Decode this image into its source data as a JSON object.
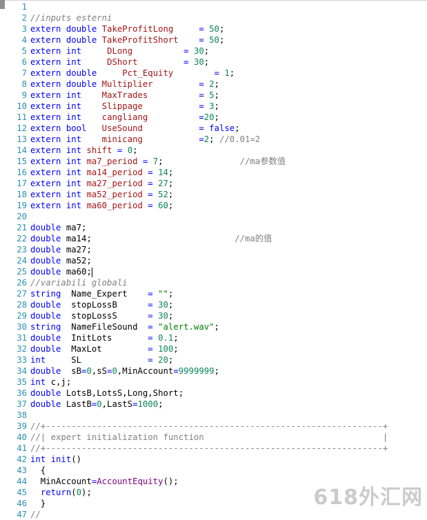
{
  "editor": {
    "lines": [
      {
        "n": "1",
        "t": []
      },
      {
        "n": "2",
        "t": [
          [
            "cm",
            "//inputs esterni"
          ]
        ]
      },
      {
        "n": "3",
        "t": [
          [
            "kw",
            "extern"
          ],
          [
            "pl",
            " "
          ],
          [
            "ty",
            "double"
          ],
          [
            "pl",
            " "
          ],
          [
            "var",
            "TakeProfitLong"
          ],
          [
            "pl",
            "     "
          ],
          [
            "kw",
            "="
          ],
          [
            "pl",
            " "
          ],
          [
            "num",
            "50"
          ],
          [
            "pl",
            ";"
          ]
        ]
      },
      {
        "n": "4",
        "t": [
          [
            "kw",
            "extern"
          ],
          [
            "pl",
            " "
          ],
          [
            "ty",
            "double"
          ],
          [
            "pl",
            " "
          ],
          [
            "var",
            "TakeProfitShort"
          ],
          [
            "pl",
            "    "
          ],
          [
            "kw",
            "="
          ],
          [
            "pl",
            " "
          ],
          [
            "num",
            "50"
          ],
          [
            "pl",
            ";"
          ]
        ]
      },
      {
        "n": "5",
        "t": [
          [
            "kw",
            "extern"
          ],
          [
            "pl",
            " "
          ],
          [
            "ty",
            "int"
          ],
          [
            "pl",
            "     "
          ],
          [
            "var",
            "DLong"
          ],
          [
            "pl",
            "          "
          ],
          [
            "kw",
            "="
          ],
          [
            "pl",
            " "
          ],
          [
            "num",
            "30"
          ],
          [
            "pl",
            ";"
          ]
        ]
      },
      {
        "n": "6",
        "t": [
          [
            "kw",
            "extern"
          ],
          [
            "pl",
            " "
          ],
          [
            "ty",
            "int"
          ],
          [
            "pl",
            "     "
          ],
          [
            "var",
            "DShort"
          ],
          [
            "pl",
            "         "
          ],
          [
            "kw",
            "="
          ],
          [
            "pl",
            " "
          ],
          [
            "num",
            "30"
          ],
          [
            "pl",
            ";"
          ]
        ]
      },
      {
        "n": "7",
        "t": [
          [
            "kw",
            "extern"
          ],
          [
            "pl",
            " "
          ],
          [
            "ty",
            "double"
          ],
          [
            "pl",
            "     "
          ],
          [
            "var",
            "Pct_Equity"
          ],
          [
            "pl",
            "        "
          ],
          [
            "kw",
            "="
          ],
          [
            "pl",
            " "
          ],
          [
            "num",
            "1"
          ],
          [
            "pl",
            ";"
          ]
        ]
      },
      {
        "n": "8",
        "t": [
          [
            "kw",
            "extern"
          ],
          [
            "pl",
            " "
          ],
          [
            "ty",
            "double"
          ],
          [
            "pl",
            " "
          ],
          [
            "var",
            "Multiplier"
          ],
          [
            "pl",
            "         "
          ],
          [
            "kw",
            "="
          ],
          [
            "pl",
            " "
          ],
          [
            "num",
            "2"
          ],
          [
            "pl",
            ";"
          ]
        ]
      },
      {
        "n": "9",
        "t": [
          [
            "kw",
            "extern"
          ],
          [
            "pl",
            " "
          ],
          [
            "ty",
            "int"
          ],
          [
            "pl",
            "    "
          ],
          [
            "var",
            "MaxTrades"
          ],
          [
            "pl",
            "          "
          ],
          [
            "kw",
            "="
          ],
          [
            "pl",
            " "
          ],
          [
            "num",
            "5"
          ],
          [
            "pl",
            ";"
          ]
        ]
      },
      {
        "n": "10",
        "t": [
          [
            "kw",
            "extern"
          ],
          [
            "pl",
            " "
          ],
          [
            "ty",
            "int"
          ],
          [
            "pl",
            "    "
          ],
          [
            "var",
            "Slippage"
          ],
          [
            "pl",
            "           "
          ],
          [
            "kw",
            "="
          ],
          [
            "pl",
            " "
          ],
          [
            "num",
            "3"
          ],
          [
            "pl",
            ";"
          ]
        ]
      },
      {
        "n": "11",
        "t": [
          [
            "kw",
            "extern"
          ],
          [
            "pl",
            " "
          ],
          [
            "ty",
            "int"
          ],
          [
            "pl",
            "    "
          ],
          [
            "var",
            "cangliang"
          ],
          [
            "pl",
            "          "
          ],
          [
            "kw",
            "="
          ],
          [
            "num",
            "20"
          ],
          [
            "pl",
            ";"
          ]
        ]
      },
      {
        "n": "12",
        "t": [
          [
            "kw",
            "extern"
          ],
          [
            "pl",
            " "
          ],
          [
            "ty",
            "bool"
          ],
          [
            "pl",
            "   "
          ],
          [
            "var",
            "UseSound"
          ],
          [
            "pl",
            "           "
          ],
          [
            "kw",
            "="
          ],
          [
            "pl",
            " "
          ],
          [
            "kw",
            "false"
          ],
          [
            "pl",
            ";"
          ]
        ]
      },
      {
        "n": "13",
        "t": [
          [
            "kw",
            "extern"
          ],
          [
            "pl",
            " "
          ],
          [
            "ty",
            "int"
          ],
          [
            "pl",
            "    "
          ],
          [
            "var",
            "minicang"
          ],
          [
            "pl",
            "           "
          ],
          [
            "kw",
            "="
          ],
          [
            "num",
            "2"
          ],
          [
            "pl",
            "; "
          ],
          [
            "cmn",
            "//0.01=2"
          ]
        ]
      },
      {
        "n": "14",
        "t": [
          [
            "kw",
            "extern"
          ],
          [
            "pl",
            " "
          ],
          [
            "ty",
            "int"
          ],
          [
            "pl",
            " "
          ],
          [
            "var",
            "shift"
          ],
          [
            "pl",
            " "
          ],
          [
            "kw",
            "="
          ],
          [
            "pl",
            " "
          ],
          [
            "num",
            "0"
          ],
          [
            "pl",
            ";"
          ]
        ]
      },
      {
        "n": "15",
        "t": [
          [
            "kw",
            "extern"
          ],
          [
            "pl",
            " "
          ],
          [
            "ty",
            "int"
          ],
          [
            "pl",
            " "
          ],
          [
            "var",
            "ma7_period"
          ],
          [
            "pl",
            " "
          ],
          [
            "kw",
            "="
          ],
          [
            "pl",
            " "
          ],
          [
            "num",
            "7"
          ],
          [
            "pl",
            ";"
          ],
          [
            "pl",
            "               "
          ],
          [
            "cmn",
            "//ma参数值"
          ]
        ]
      },
      {
        "n": "16",
        "t": [
          [
            "kw",
            "extern"
          ],
          [
            "pl",
            " "
          ],
          [
            "ty",
            "int"
          ],
          [
            "pl",
            " "
          ],
          [
            "var",
            "ma14_period"
          ],
          [
            "pl",
            " "
          ],
          [
            "kw",
            "="
          ],
          [
            "pl",
            " "
          ],
          [
            "num",
            "14"
          ],
          [
            "pl",
            ";"
          ]
        ]
      },
      {
        "n": "17",
        "t": [
          [
            "kw",
            "extern"
          ],
          [
            "pl",
            " "
          ],
          [
            "ty",
            "int"
          ],
          [
            "pl",
            " "
          ],
          [
            "var",
            "ma27_period"
          ],
          [
            "pl",
            " "
          ],
          [
            "kw",
            "="
          ],
          [
            "pl",
            " "
          ],
          [
            "num",
            "27"
          ],
          [
            "pl",
            ";"
          ]
        ]
      },
      {
        "n": "18",
        "t": [
          [
            "kw",
            "extern"
          ],
          [
            "pl",
            " "
          ],
          [
            "ty",
            "int"
          ],
          [
            "pl",
            " "
          ],
          [
            "var",
            "ma52_period"
          ],
          [
            "pl",
            " "
          ],
          [
            "kw",
            "="
          ],
          [
            "pl",
            " "
          ],
          [
            "num",
            "52"
          ],
          [
            "pl",
            ";"
          ]
        ]
      },
      {
        "n": "19",
        "t": [
          [
            "kw",
            "extern"
          ],
          [
            "pl",
            " "
          ],
          [
            "ty",
            "int"
          ],
          [
            "pl",
            " "
          ],
          [
            "var",
            "ma60_period"
          ],
          [
            "pl",
            " "
          ],
          [
            "kw",
            "="
          ],
          [
            "pl",
            " "
          ],
          [
            "num",
            "60"
          ],
          [
            "pl",
            ";"
          ]
        ]
      },
      {
        "n": "20",
        "t": []
      },
      {
        "n": "21",
        "t": [
          [
            "ty",
            "double"
          ],
          [
            "pl",
            " ma7;"
          ]
        ]
      },
      {
        "n": "22",
        "t": [
          [
            "ty",
            "double"
          ],
          [
            "pl",
            " ma14;"
          ],
          [
            "pl",
            "                            "
          ],
          [
            "cmn",
            "//ma的值"
          ]
        ]
      },
      {
        "n": "23",
        "t": [
          [
            "ty",
            "double"
          ],
          [
            "pl",
            " ma27;"
          ]
        ]
      },
      {
        "n": "24",
        "t": [
          [
            "ty",
            "double"
          ],
          [
            "pl",
            " ma52;"
          ]
        ]
      },
      {
        "n": "25",
        "t": [
          [
            "ty",
            "double"
          ],
          [
            "pl",
            " ma60;"
          ],
          [
            "cursor",
            ""
          ]
        ]
      },
      {
        "n": "26",
        "t": [
          [
            "cm",
            "//variabili globali"
          ]
        ]
      },
      {
        "n": "27",
        "t": [
          [
            "ty",
            "string"
          ],
          [
            "pl",
            "  Name_Expert    "
          ],
          [
            "kw",
            "="
          ],
          [
            "pl",
            " "
          ],
          [
            "str",
            "\"\""
          ],
          [
            "pl",
            ";"
          ]
        ]
      },
      {
        "n": "28",
        "t": [
          [
            "ty",
            "double"
          ],
          [
            "pl",
            "  stopLossB      "
          ],
          [
            "kw",
            "="
          ],
          [
            "pl",
            " "
          ],
          [
            "num",
            "30"
          ],
          [
            "pl",
            ";"
          ]
        ]
      },
      {
        "n": "29",
        "t": [
          [
            "ty",
            "double"
          ],
          [
            "pl",
            "  stopLossS      "
          ],
          [
            "kw",
            "="
          ],
          [
            "pl",
            " "
          ],
          [
            "num",
            "30"
          ],
          [
            "pl",
            ";"
          ]
        ]
      },
      {
        "n": "30",
        "t": [
          [
            "ty",
            "string"
          ],
          [
            "pl",
            "  NameFileSound  "
          ],
          [
            "kw",
            "="
          ],
          [
            "pl",
            " "
          ],
          [
            "str",
            "\"alert.wav\""
          ],
          [
            "pl",
            ";"
          ]
        ]
      },
      {
        "n": "31",
        "t": [
          [
            "ty",
            "double"
          ],
          [
            "pl",
            "  InitLots       "
          ],
          [
            "kw",
            "="
          ],
          [
            "pl",
            " "
          ],
          [
            "num",
            "0.1"
          ],
          [
            "pl",
            ";"
          ]
        ]
      },
      {
        "n": "32",
        "t": [
          [
            "ty",
            "double"
          ],
          [
            "pl",
            "  MaxLot         "
          ],
          [
            "kw",
            "="
          ],
          [
            "pl",
            " "
          ],
          [
            "num",
            "100"
          ],
          [
            "pl",
            ";"
          ]
        ]
      },
      {
        "n": "33",
        "t": [
          [
            "ty",
            "int"
          ],
          [
            "pl",
            "     SL             "
          ],
          [
            "kw",
            "="
          ],
          [
            "pl",
            " "
          ],
          [
            "num",
            "20"
          ],
          [
            "pl",
            ";"
          ]
        ]
      },
      {
        "n": "34",
        "t": [
          [
            "ty",
            "double"
          ],
          [
            "pl",
            "  sB"
          ],
          [
            "kw",
            "="
          ],
          [
            "num",
            "0"
          ],
          [
            "pl",
            ",sS"
          ],
          [
            "kw",
            "="
          ],
          [
            "num",
            "0"
          ],
          [
            "pl",
            ",MinAccount"
          ],
          [
            "kw",
            "="
          ],
          [
            "num",
            "9999999"
          ],
          [
            "pl",
            ";"
          ]
        ]
      },
      {
        "n": "35",
        "t": [
          [
            "ty",
            "int"
          ],
          [
            "pl",
            " c,j;"
          ]
        ]
      },
      {
        "n": "36",
        "t": [
          [
            "ty",
            "double"
          ],
          [
            "pl",
            " LotsB,LotsS,Long,Short;"
          ]
        ]
      },
      {
        "n": "37",
        "t": [
          [
            "ty",
            "double"
          ],
          [
            "pl",
            " LastB"
          ],
          [
            "kw",
            "="
          ],
          [
            "num",
            "0"
          ],
          [
            "pl",
            ",LastS"
          ],
          [
            "kw",
            "="
          ],
          [
            "num",
            "1000"
          ],
          [
            "pl",
            ";"
          ]
        ]
      },
      {
        "n": "38",
        "t": []
      },
      {
        "n": "39",
        "t": [
          [
            "cmn",
            "//+------------------------------------------------------------------+"
          ]
        ]
      },
      {
        "n": "40",
        "t": [
          [
            "cmn",
            "//| expert initialization function                                   |"
          ]
        ]
      },
      {
        "n": "41",
        "t": [
          [
            "cmn",
            "//+------------------------------------------------------------------+"
          ]
        ]
      },
      {
        "n": "42",
        "t": [
          [
            "ty",
            "int"
          ],
          [
            "pl",
            " "
          ],
          [
            "fn",
            "init"
          ],
          [
            "pl",
            "()"
          ]
        ]
      },
      {
        "n": "43",
        "t": [
          [
            "pl",
            "  {"
          ]
        ]
      },
      {
        "n": "44",
        "t": [
          [
            "pl",
            "  MinAccount"
          ],
          [
            "kw",
            "="
          ],
          [
            "afn",
            "AccountEquity"
          ],
          [
            "pl",
            "();"
          ]
        ]
      },
      {
        "n": "45",
        "t": [
          [
            "pl",
            "  "
          ],
          [
            "kw",
            "return"
          ],
          [
            "pl",
            "("
          ],
          [
            "num",
            "0"
          ],
          [
            "pl",
            ");"
          ]
        ]
      },
      {
        "n": "46",
        "t": [
          [
            "pl",
            "  }"
          ]
        ]
      },
      {
        "n": "47",
        "t": [
          [
            "cmn",
            "//"
          ]
        ]
      }
    ]
  },
  "watermark": {
    "text": "618外汇网"
  }
}
